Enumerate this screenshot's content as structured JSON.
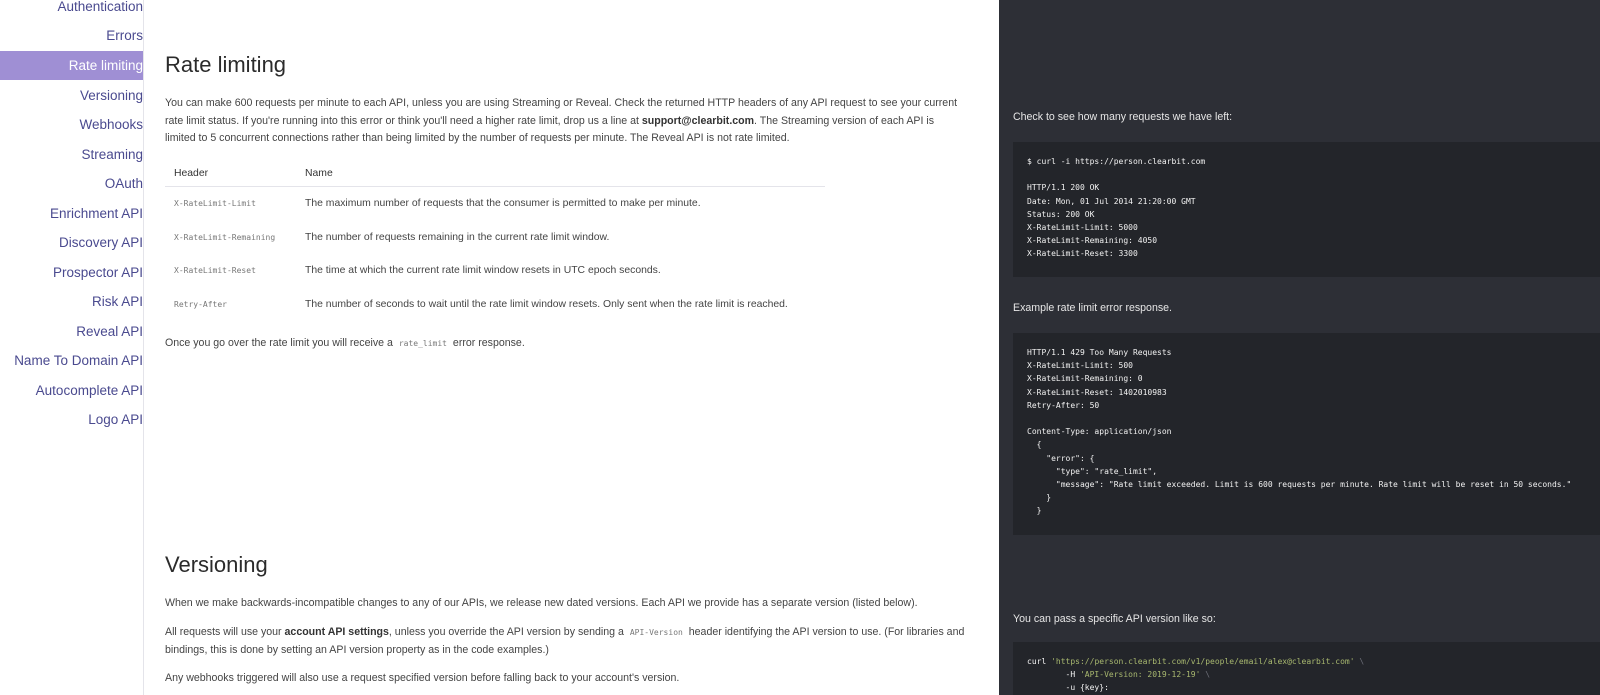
{
  "sidebar": {
    "items": [
      {
        "label": "Authentication",
        "active": false
      },
      {
        "label": "Errors",
        "active": false
      },
      {
        "label": "Rate limiting",
        "active": true
      },
      {
        "label": "Versioning",
        "active": false
      },
      {
        "label": "Webhooks",
        "active": false
      },
      {
        "label": "Streaming",
        "active": false
      },
      {
        "label": "OAuth",
        "active": false
      },
      {
        "label": "Enrichment API",
        "active": false
      },
      {
        "label": "Discovery API",
        "active": false
      },
      {
        "label": "Prospector API",
        "active": false
      },
      {
        "label": "Risk API",
        "active": false
      },
      {
        "label": "Reveal API",
        "active": false
      },
      {
        "label": "Name To Domain API",
        "active": false
      },
      {
        "label": "Autocomplete API",
        "active": false
      },
      {
        "label": "Logo API",
        "active": false
      }
    ]
  },
  "rate_limiting": {
    "title": "Rate limiting",
    "intro_1": "You can make 600 requests per minute to each API, unless you are using Streaming or Reveal. Check the returned HTTP headers of any API request to see your current rate limit status. If you're running into this error or think you'll need a higher rate limit, drop us a line at ",
    "email": "support@clearbit.com",
    "intro_2": ". The Streaming version of each API is limited to 5 concurrent connections rather than being limited by the number of requests per minute. The Reveal API is not rate limited.",
    "table": {
      "col_header": "Header",
      "col_name": "Name",
      "rows": [
        {
          "header": "X-RateLimit-Limit",
          "name": "The maximum number of requests that the consumer is permitted to make per minute."
        },
        {
          "header": "X-RateLimit-Remaining",
          "name": "The number of requests remaining in the current rate limit window."
        },
        {
          "header": "X-RateLimit-Reset",
          "name": "The time at which the current rate limit window resets in UTC epoch seconds."
        },
        {
          "header": "Retry-After",
          "name": "The number of seconds to wait until the rate limit window resets. Only sent when the rate limit is reached."
        }
      ]
    },
    "after_1": "Once you go over the rate limit you will receive a ",
    "after_code": "rate_limit",
    "after_2": " error response."
  },
  "versioning": {
    "title": "Versioning",
    "p1": "When we make backwards-incompatible changes to any of our APIs, we release new dated versions. Each API we provide has a separate version (listed below).",
    "p2_a": "All requests will use your ",
    "p2_bold": "account API settings",
    "p2_b": ", unless you override the API version by sending a ",
    "p2_code": "API-Version",
    "p2_c": " header identifying the API version to use. (For libraries and bindings, this is done by setting an API version property as in the code examples.)",
    "p3": "Any webhooks triggered will also use a request specified version before falling back to your account's version."
  },
  "code_panel": {
    "caption_1": "Check to see how many requests we have left:",
    "code_1": "$ curl -i https://person.clearbit.com\n\nHTTP/1.1 200 OK\nDate: Mon, 01 Jul 2014 21:20:00 GMT\nStatus: 200 OK\nX-RateLimit-Limit: 5000\nX-RateLimit-Remaining: 4050\nX-RateLimit-Reset: 3300",
    "caption_2": "Example rate limit error response.",
    "code_2": "HTTP/1.1 429 Too Many Requests\nX-RateLimit-Limit: 500\nX-RateLimit-Remaining: 0\nX-RateLimit-Reset: 1402010983\nRetry-After: 50\n\nContent-Type: application/json\n  {\n    \"error\": {\n      \"type\": \"rate_limit\",\n      \"message\": \"Rate limit exceeded. Limit is 600 requests per minute. Rate limit will be reset in 50 seconds.\"\n    }\n  }",
    "caption_3": "You can pass a specific API version like so:",
    "code_3_cmd": "curl ",
    "code_3_url": "'https://person.clearbit.com/v1/people/email/alex@clearbit.com'",
    "code_3_bs": " \\",
    "code_3_flag_h": "        -H ",
    "code_3_hval": "'API-Version: 2019-12-19'",
    "code_3_user": "        -u {key}:"
  }
}
